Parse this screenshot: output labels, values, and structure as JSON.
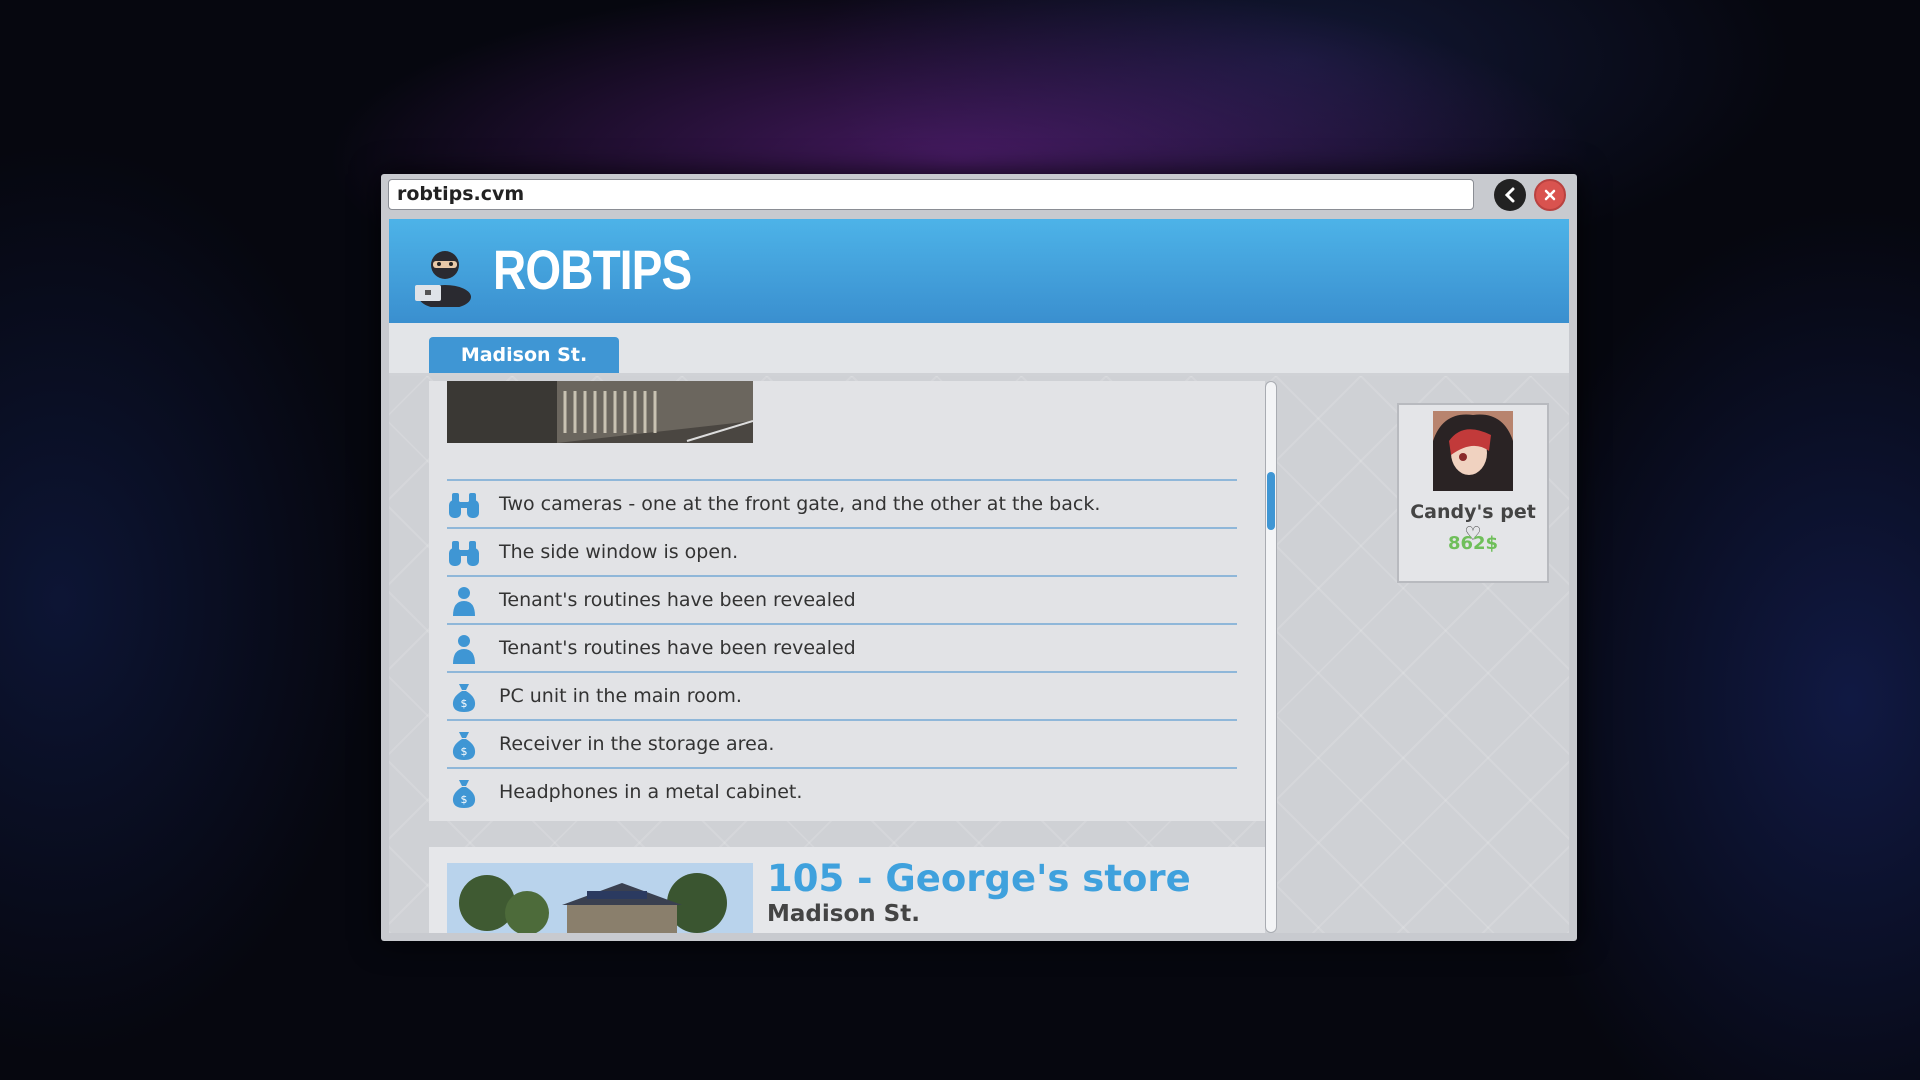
{
  "browser": {
    "url": "robtips.cvm"
  },
  "site": {
    "brand": "ROBTIPS"
  },
  "tabs": [
    {
      "label": "Madison St."
    }
  ],
  "tips": [
    {
      "icon": "binoculars-icon",
      "text": "Two cameras - one at the front gate, and the other at the back."
    },
    {
      "icon": "binoculars-icon",
      "text": "The side window is open."
    },
    {
      "icon": "person-icon",
      "text": "Tenant's routines have been revealed"
    },
    {
      "icon": "person-icon",
      "text": "Tenant's routines have been revealed"
    },
    {
      "icon": "money-bag-icon",
      "text": "PC unit in the main room."
    },
    {
      "icon": "money-bag-icon",
      "text": "Receiver in the storage area."
    },
    {
      "icon": "money-bag-icon",
      "text": "Headphones in a metal cabinet."
    }
  ],
  "listing": {
    "title": "105 - George's store",
    "street": "Madison St."
  },
  "profile": {
    "name": "Candy's pet ♡",
    "money": "862$"
  },
  "colors": {
    "accent": "#3f96d4",
    "header": "#4db3e8",
    "money": "#6fbf5a",
    "close": "#d9534f"
  }
}
